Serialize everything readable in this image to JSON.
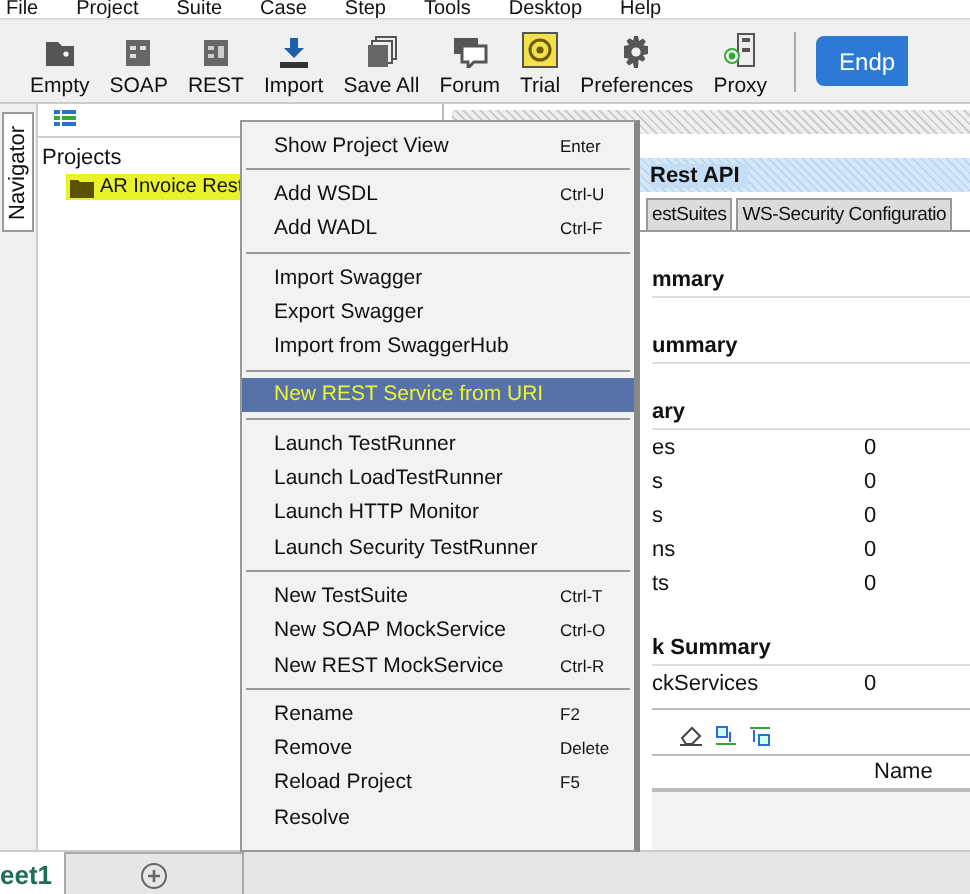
{
  "menubar": [
    "File",
    "Project",
    "Suite",
    "Case",
    "Step",
    "Tools",
    "Desktop",
    "Help"
  ],
  "toolbar": [
    {
      "label": "Empty",
      "kind": "empty"
    },
    {
      "label": "SOAP",
      "kind": "soap"
    },
    {
      "label": "REST",
      "kind": "rest"
    },
    {
      "label": "Import",
      "kind": "import"
    },
    {
      "label": "Save All",
      "kind": "save"
    },
    {
      "label": "Forum",
      "kind": "forum"
    },
    {
      "label": "Trial",
      "kind": "trial"
    },
    {
      "label": "Preferences",
      "kind": "gear"
    },
    {
      "label": "Proxy",
      "kind": "proxy"
    }
  ],
  "endpoint_button": "Endp",
  "navigator_tab": "Navigator",
  "navigator": {
    "heading": "Projects",
    "items": [
      {
        "label": "AR Invoice Rest",
        "highlighted": true
      }
    ]
  },
  "project_panel": {
    "title": "Rest API",
    "tabs": [
      "estSuites",
      "WS-Security Configuratio"
    ],
    "sections": [
      {
        "heading": "mmary"
      },
      {
        "heading": "ummary"
      },
      {
        "heading": "ary",
        "rows": [
          {
            "label": "es",
            "value": "0"
          },
          {
            "label": "s",
            "value": "0"
          },
          {
            "label": "s",
            "value": "0"
          },
          {
            "label": "ns",
            "value": "0"
          },
          {
            "label": "ts",
            "value": "0"
          }
        ]
      },
      {
        "heading": "k Summary",
        "rows": [
          {
            "label": "ckServices",
            "value": "0"
          }
        ]
      }
    ],
    "table_header": "Name"
  },
  "context_menu": [
    [
      {
        "label": "Show Project View",
        "shortcut": "Enter",
        "selected": false
      }
    ],
    [
      {
        "label": "Add WSDL",
        "shortcut": "Ctrl-U",
        "selected": false
      },
      {
        "label": "Add WADL",
        "shortcut": "Ctrl-F",
        "selected": false
      }
    ],
    [
      {
        "label": "Import Swagger",
        "selected": false
      },
      {
        "label": "Export Swagger",
        "selected": false
      },
      {
        "label": "Import from SwaggerHub",
        "selected": false
      }
    ],
    [
      {
        "label": "New REST Service from URI",
        "selected": true
      }
    ],
    [
      {
        "label": "Launch TestRunner",
        "selected": false
      },
      {
        "label": "Launch LoadTestRunner",
        "selected": false
      },
      {
        "label": "Launch HTTP Monitor",
        "selected": false
      },
      {
        "label": "Launch Security TestRunner",
        "selected": false
      }
    ],
    [
      {
        "label": "New TestSuite",
        "shortcut": "Ctrl-T",
        "selected": false
      },
      {
        "label": "New SOAP MockService",
        "shortcut": "Ctrl-O",
        "selected": false
      },
      {
        "label": "New REST MockService",
        "shortcut": "Ctrl-R",
        "selected": false
      }
    ],
    [
      {
        "label": "Rename",
        "shortcut": "F2",
        "selected": false
      },
      {
        "label": "Remove",
        "shortcut": "Delete",
        "selected": false
      },
      {
        "label": "Reload Project",
        "shortcut": "F5",
        "selected": false
      },
      {
        "label": "Resolve",
        "selected": false
      }
    ]
  ],
  "sheet_tab": "eet1"
}
